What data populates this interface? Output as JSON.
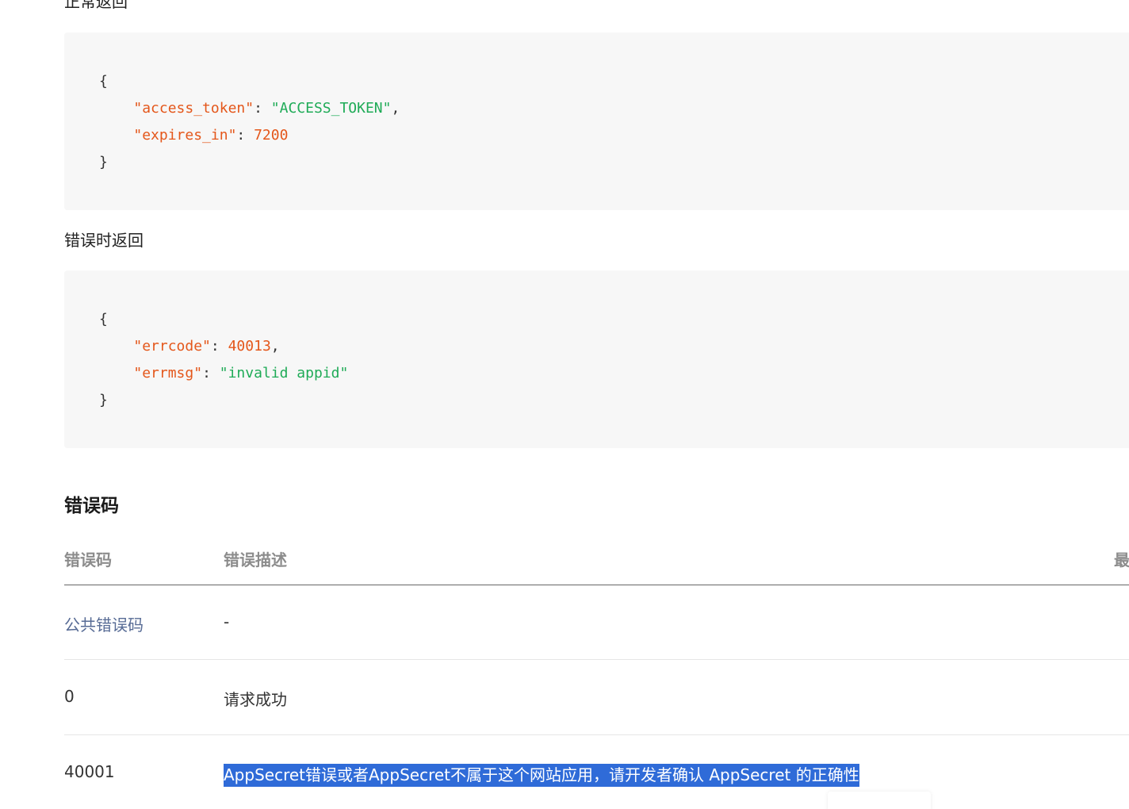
{
  "normal_return": {
    "label": "正常返回",
    "code": {
      "open": "{",
      "line1_key": "\"access_token\"",
      "line1_colon": ": ",
      "line1_value": "\"ACCESS_TOKEN\"",
      "line1_comma": ",",
      "line2_key": "\"expires_in\"",
      "line2_colon": ": ",
      "line2_value": "7200",
      "close": "}"
    }
  },
  "error_return": {
    "label": "错误时返回",
    "code": {
      "open": "{",
      "line1_key": "\"errcode\"",
      "line1_colon": ": ",
      "line1_value": "40013",
      "line1_comma": ",",
      "line2_key": "\"errmsg\"",
      "line2_colon": ": ",
      "line2_value": "\"invalid appid\"",
      "close": "}"
    }
  },
  "error_codes": {
    "title": "错误码",
    "headers": {
      "code": "错误码",
      "description": "错误描述",
      "third": "最"
    },
    "rows": [
      {
        "code": "公共错误码",
        "description": "-"
      },
      {
        "code": "0",
        "description": "请求成功"
      },
      {
        "code": "40001",
        "description": "AppSecret错误或者AppSecret不属于这个网站应用，请开发者确认 AppSecret 的正确性"
      }
    ]
  },
  "colors": {
    "code_bg": "#f7f7f7",
    "json_key": "#e4571b",
    "json_string": "#1fab57",
    "link": "#576b95",
    "selection": "#2f6bd8"
  }
}
